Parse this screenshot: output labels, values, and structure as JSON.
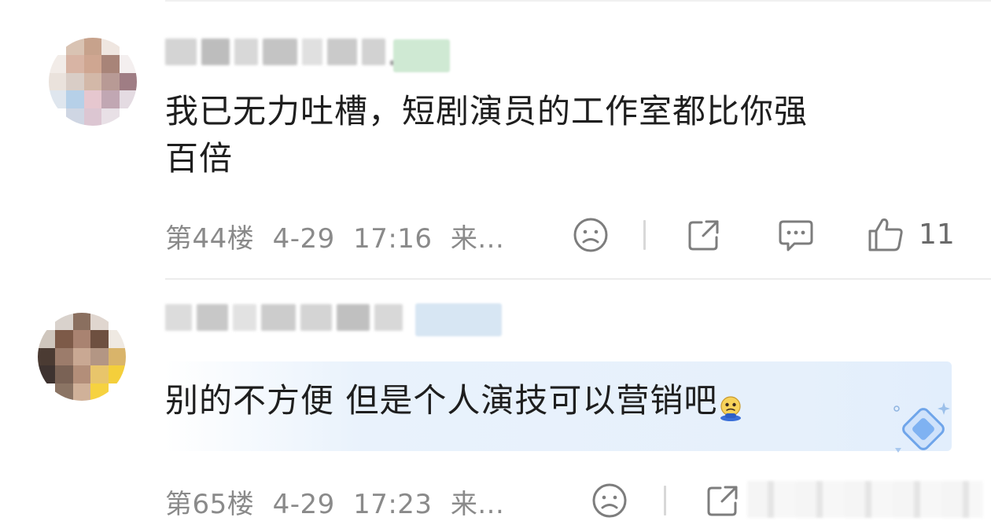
{
  "comments": [
    {
      "text_line1": "我已无力吐槽，短剧演员的工作室都比你强",
      "text_line2": "百倍",
      "floor": "第44楼",
      "date": "4-29",
      "time": "17:16",
      "source": "来...",
      "likes": "11"
    },
    {
      "text": "别的不方便 但是个人演技可以营销吧",
      "emoji": "pleading-face-emoji",
      "floor": "第65楼",
      "date": "4-29",
      "time": "17:23",
      "source": "来..."
    }
  ],
  "colors": {
    "meta_gray": "#8a8a8a",
    "highlight_blue": "#e6f0fb",
    "badge_green": "#cfe9d3",
    "badge_blue": "#d7e6f3"
  },
  "icons": [
    "sad-face-icon",
    "share-icon",
    "comment-icon",
    "thumbs-up-icon",
    "diamond-icon"
  ]
}
